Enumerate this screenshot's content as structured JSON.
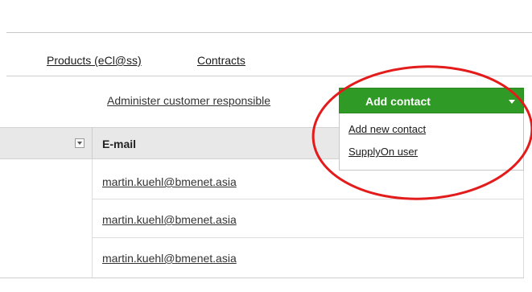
{
  "nav": {
    "tabs": [
      {
        "label": "Products (eCl@ss)"
      },
      {
        "label": "Contracts"
      }
    ]
  },
  "toolbar": {
    "admin_link": "Administer customer responsible",
    "add_contact_label": "Add contact"
  },
  "dropdown": {
    "items": [
      {
        "label": "Add new contact"
      },
      {
        "label": "SupplyOn user"
      }
    ]
  },
  "grid": {
    "column_header": "E-mail",
    "rows": [
      {
        "email": "martin.kuehl@bmenet.asia"
      },
      {
        "email": "martin.kuehl@bmenet.asia"
      },
      {
        "email": "martin.kuehl@bmenet.asia"
      }
    ]
  },
  "colors": {
    "accent_green": "#2f9a25",
    "highlight_ellipse": "#e31b1b",
    "header_bg": "#e8e8e8"
  },
  "icons": {
    "filter": "filter-dropdown-icon",
    "caret": "chevron-down-icon"
  }
}
